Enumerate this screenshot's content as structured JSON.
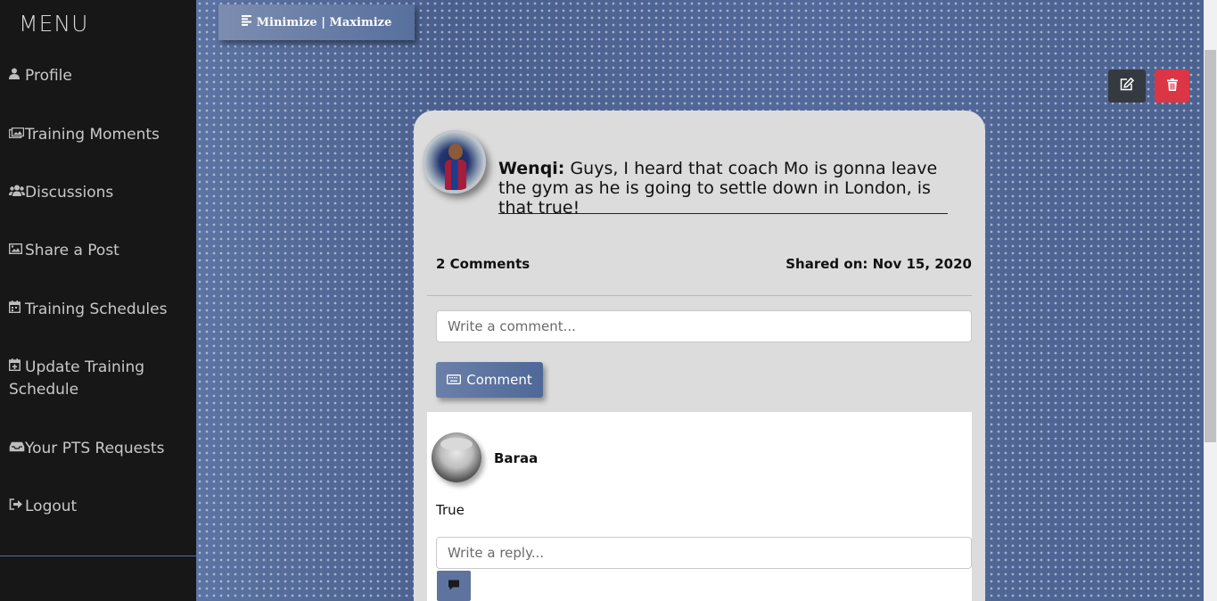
{
  "sidebar": {
    "title": "MENU",
    "items": [
      {
        "label": "Profile",
        "icon": "user-icon"
      },
      {
        "label": "Training Moments",
        "icon": "images-icon"
      },
      {
        "label": "Discussions",
        "icon": "users-icon"
      },
      {
        "label": "Share a Post",
        "icon": "image-icon"
      },
      {
        "label": "Training Schedules",
        "icon": "calendar-icon"
      },
      {
        "label": "Update Training Schedule",
        "icon": "calendar-plus-icon"
      },
      {
        "label": "Your PTS Requests",
        "icon": "inbox-icon"
      },
      {
        "label": "Logout",
        "icon": "sign-out-icon"
      }
    ]
  },
  "toolbar": {
    "minmax_label": "Minimize | Maximize"
  },
  "post": {
    "author": "Wenqi:",
    "text": " Guys, I heard that coach Mo is gonna leave the gym as he is going to settle down in London, is that true!",
    "comments_count": "2 Comments",
    "shared_on": "Shared on: Nov 15, 2020",
    "comment_placeholder": "Write a comment...",
    "comment_button": "Comment"
  },
  "comment": {
    "author": "Baraa",
    "text": "True",
    "reply_placeholder": "Write a reply..."
  },
  "colors": {
    "sidebar_bg": "#171717",
    "delete": "#dc3545",
    "edit": "#343a40",
    "accent": "#4f6898"
  }
}
